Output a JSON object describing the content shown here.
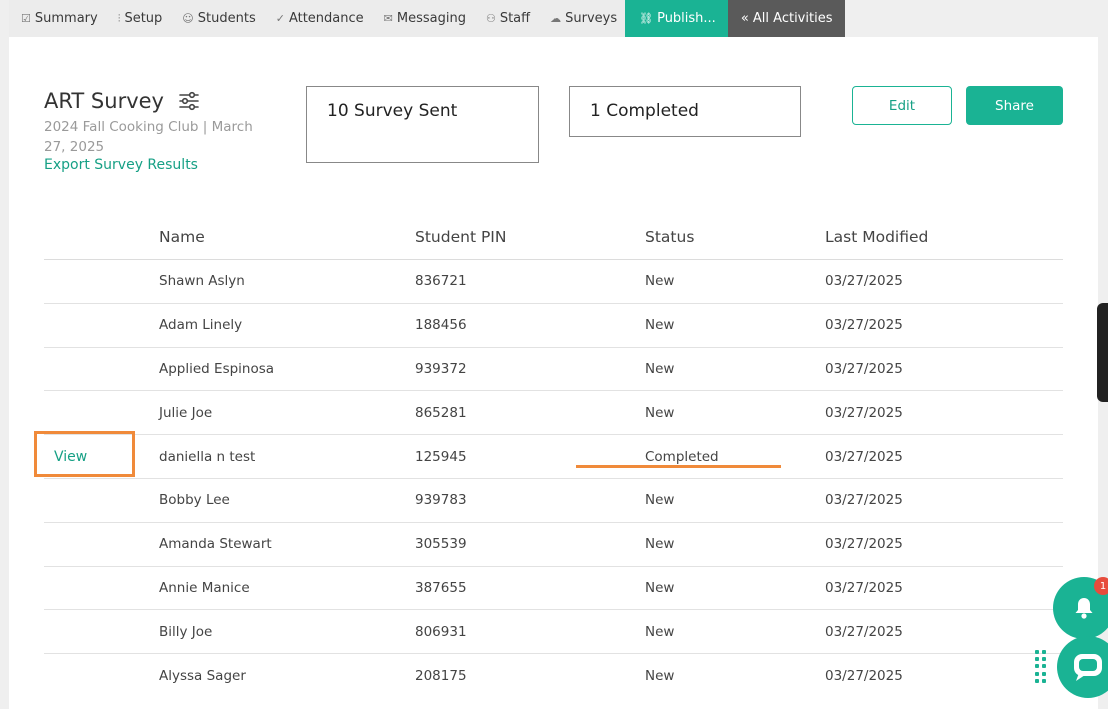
{
  "nav": [
    {
      "icon": "☑",
      "icon_name": "summary-icon",
      "label": "Summary"
    },
    {
      "icon": "⫶",
      "icon_name": "setup-icon",
      "label": "Setup"
    },
    {
      "icon": "☺",
      "icon_name": "students-icon",
      "label": "Students"
    },
    {
      "icon": "✓",
      "icon_name": "attendance-icon",
      "label": "Attendance"
    },
    {
      "icon": "✉",
      "icon_name": "messaging-icon",
      "label": "Messaging"
    },
    {
      "icon": "⚇",
      "icon_name": "staff-icon",
      "label": "Staff"
    },
    {
      "icon": "☁",
      "icon_name": "surveys-icon",
      "label": "Surveys"
    },
    {
      "icon": "⛓",
      "icon_name": "link-icon",
      "label": "Publish..."
    },
    {
      "icon": "",
      "icon_name": "",
      "label": "« All Activities"
    }
  ],
  "header": {
    "title": "ART Survey",
    "subtitle": "2024 Fall Cooking Club | March 27, 2025",
    "export_label": "Export Survey Results"
  },
  "stats": {
    "sent": "10 Survey Sent",
    "completed": "1 Completed"
  },
  "buttons": {
    "edit": "Edit",
    "share": "Share"
  },
  "table": {
    "columns": [
      "Name",
      "Student PIN",
      "Status",
      "Last Modified"
    ],
    "rows": [
      {
        "action": "",
        "name": "Shawn Aslyn",
        "pin": "836721",
        "status": "New",
        "modified": "03/27/2025"
      },
      {
        "action": "",
        "name": "Adam Linely",
        "pin": "188456",
        "status": "New",
        "modified": "03/27/2025"
      },
      {
        "action": "",
        "name": "Applied Espinosa",
        "pin": "939372",
        "status": "New",
        "modified": "03/27/2025"
      },
      {
        "action": "",
        "name": "Julie Joe",
        "pin": "865281",
        "status": "New",
        "modified": "03/27/2025"
      },
      {
        "action": "View",
        "name": "daniella n test",
        "pin": "125945",
        "status": "Completed",
        "modified": "03/27/2025"
      },
      {
        "action": "",
        "name": "Bobby Lee",
        "pin": "939783",
        "status": "New",
        "modified": "03/27/2025"
      },
      {
        "action": "",
        "name": "Amanda Stewart",
        "pin": "305539",
        "status": "New",
        "modified": "03/27/2025"
      },
      {
        "action": "",
        "name": "Annie Manice",
        "pin": "387655",
        "status": "New",
        "modified": "03/27/2025"
      },
      {
        "action": "",
        "name": "Billy Joe",
        "pin": "806931",
        "status": "New",
        "modified": "03/27/2025"
      },
      {
        "action": "",
        "name": "Alyssa Sager",
        "pin": "208175",
        "status": "New",
        "modified": "03/27/2025"
      }
    ]
  },
  "widgets": {
    "notification_count": "1"
  },
  "colors": {
    "accent": "#1ab394",
    "highlight": "#f08a3a",
    "badge": "#e74c3c"
  }
}
